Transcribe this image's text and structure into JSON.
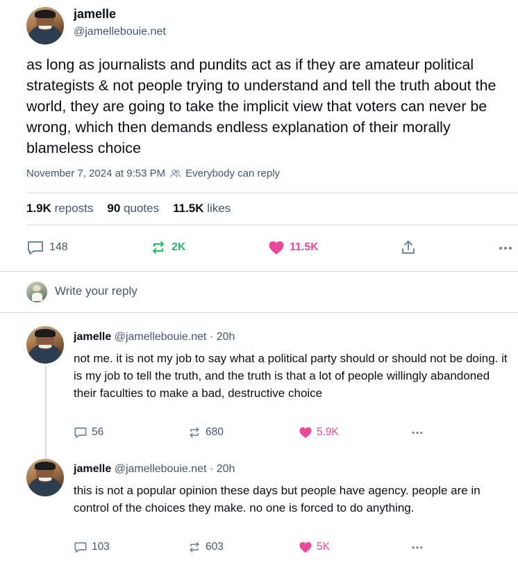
{
  "post": {
    "author_name": "jamelle",
    "author_handle": "@jamellebouie.net",
    "text": "as long as journalists and pundits act as if they are amateur political strategists & not people trying to understand and tell the truth about the world, they are going to take the implicit view that voters can never be wrong, which then demands endless explanation of their morally blameless choice",
    "timestamp": "November 7, 2024 at 9:53 PM",
    "reply_setting": "Everybody can reply"
  },
  "stats": {
    "reposts_count": "1.9K",
    "reposts_label": "reposts",
    "quotes_count": "90",
    "quotes_label": "quotes",
    "likes_count": "11.5K",
    "likes_label": "likes"
  },
  "actions": {
    "replies": "148",
    "reposts": "2K",
    "likes": "11.5K"
  },
  "reply_box": {
    "placeholder": "Write your reply"
  },
  "replies": [
    {
      "author_name": "jamelle",
      "author_handle": "@jamellebouie.net",
      "separator": "·",
      "age": "20h",
      "text": "not me. it is not my job to say what a political party should or should not be doing. it is my job to tell the truth, and the truth is that a lot of people willingly abandoned their faculties to make a bad, destructive choice",
      "replies": "56",
      "reposts": "680",
      "likes": "5.9K"
    },
    {
      "author_name": "jamelle",
      "author_handle": "@jamellebouie.net",
      "separator": "·",
      "age": "20h",
      "text": "this is not a popular opinion these days but people have agency. people are in control of the choices they make. no one is forced to do anything.",
      "replies": "103",
      "reposts": "603",
      "likes": "5K"
    }
  ],
  "colors": {
    "text": "#0b0f14",
    "muted": "#42576c",
    "repost_active": "#20bc67",
    "like_active": "#ec4899",
    "divider": "#d4dbe2"
  },
  "icons": [
    "people-icon",
    "reply-icon",
    "repost-icon",
    "heart-icon",
    "share-icon",
    "more-icon"
  ]
}
